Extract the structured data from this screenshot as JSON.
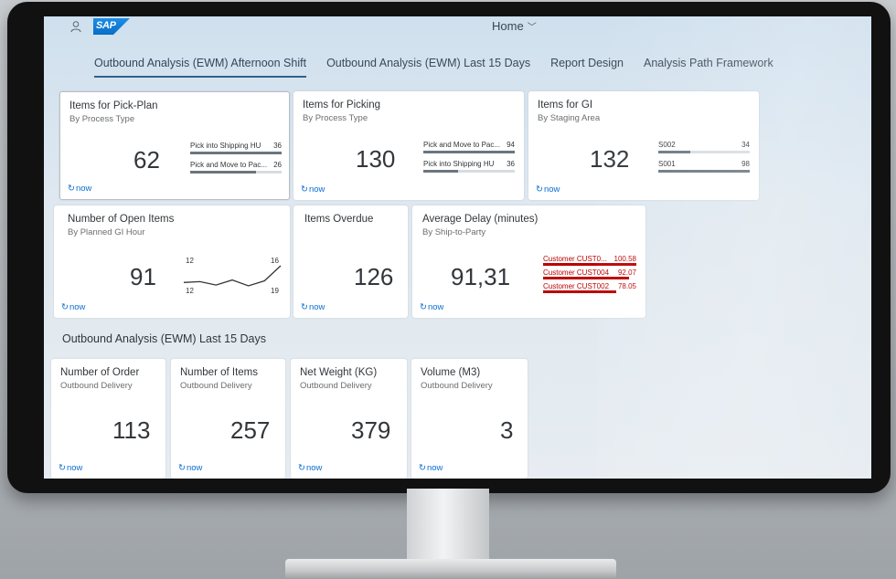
{
  "shell": {
    "title": "Home",
    "logo": "SAP",
    "user_icon": "person-icon",
    "chevron_icon": "chevron-down-icon"
  },
  "tabs": [
    {
      "label": "Outbound Analysis (EWM) Afternoon Shift",
      "active": true
    },
    {
      "label": "Outbound Analysis (EWM) Last 15 Days",
      "active": false
    },
    {
      "label": "Report Design",
      "active": false
    },
    {
      "label": "Analysis Path Framework",
      "active": false
    }
  ],
  "refresh_text": "now",
  "tiles": {
    "pick_plan": {
      "title": "Items for Pick-Plan",
      "subtitle": "By Process Type",
      "kpi": "62",
      "bars": [
        {
          "label": "Pick into Shipping HU",
          "value": "36",
          "fraction": 1.0
        },
        {
          "label": "Pick and Move to Pac...",
          "value": "26",
          "fraction": 0.72
        }
      ]
    },
    "picking": {
      "title": "Items for Picking",
      "subtitle": "By Process Type",
      "kpi": "130",
      "bars": [
        {
          "label": "Pick and Move to Pac...",
          "value": "94",
          "fraction": 1.0
        },
        {
          "label": "Pick into Shipping HU",
          "value": "36",
          "fraction": 0.38
        }
      ]
    },
    "gi": {
      "title": "Items for GI",
      "subtitle": "By Staging Area",
      "kpi": "132",
      "bars": [
        {
          "label": "S002",
          "value": "34",
          "fraction": 0.35
        },
        {
          "label": "S001",
          "value": "98",
          "fraction": 1.0
        }
      ]
    },
    "open_items": {
      "title": "Number of Open Items",
      "subtitle": "By Planned GI Hour",
      "kpi": "91",
      "line": {
        "start_top": "12",
        "start_bottom": "12",
        "end_top": "16",
        "end_bottom": "19",
        "points": [
          12.0,
          12.2,
          11.4,
          12.6,
          11.2,
          12.4,
          16.0
        ]
      }
    },
    "overdue": {
      "title": "Items Overdue",
      "subtitle": "",
      "kpi": "126"
    },
    "avg_delay": {
      "title": "Average Delay (minutes)",
      "subtitle": "By Ship-to-Party",
      "kpi": "91,31",
      "bars": [
        {
          "label": "Customer CUST0...",
          "value": "100.58",
          "fraction": 1.0
        },
        {
          "label": "Customer CUST004",
          "value": "92.07",
          "fraction": 0.92
        },
        {
          "label": "Customer CUST002",
          "value": "78.05",
          "fraction": 0.78
        }
      ]
    },
    "orders": {
      "title": "Number of Order",
      "subtitle": "Outbound Delivery",
      "kpi": "113"
    },
    "items": {
      "title": "Number of Items",
      "subtitle": "Outbound Delivery",
      "kpi": "257"
    },
    "net_weight": {
      "title": "Net Weight (KG)",
      "subtitle": "Outbound Delivery",
      "kpi": "379"
    },
    "volume": {
      "title": "Volume (M3)",
      "subtitle": "Outbound Delivery",
      "kpi": "3"
    }
  },
  "section2": {
    "title": "Outbound Analysis (EWM) Last 15 Days"
  },
  "colors": {
    "accent": "#0a6ed1",
    "critical": "#bb0000",
    "neutral_bar": "#6a7680"
  }
}
